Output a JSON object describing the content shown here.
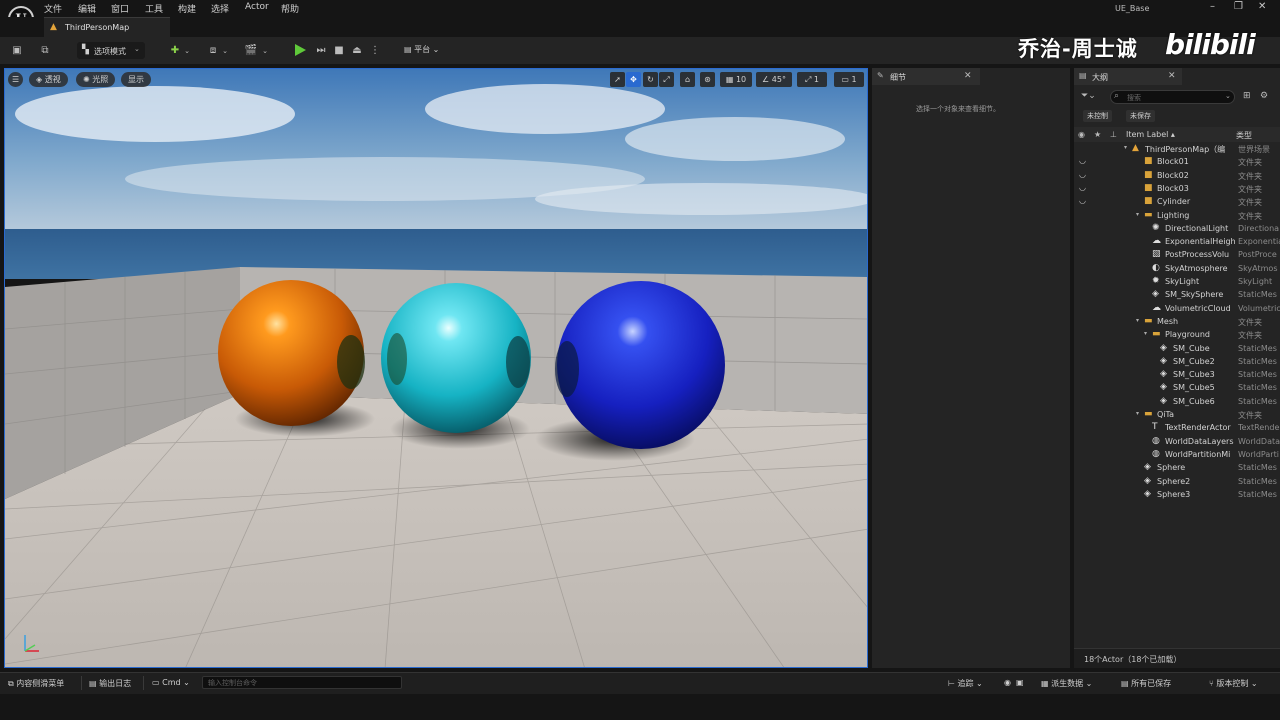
{
  "app": {
    "name": "UE_Base"
  },
  "menu": [
    "文件",
    "编辑",
    "窗口",
    "工具",
    "构建",
    "选择",
    "Actor",
    "帮助"
  ],
  "tab": {
    "map_name": "ThirdPersonMap"
  },
  "toolbar": {
    "select_mode": "选项模式",
    "platform": "平台"
  },
  "watermark": {
    "author": "乔治-周士诚",
    "site": "bilibili"
  },
  "viewport": {
    "perspective": "透视",
    "lit": "光照",
    "show": "显示",
    "grid_snap": "10",
    "angle_snap": "45°",
    "scale_snap": "1",
    "camera_speed": "1"
  },
  "details": {
    "title": "细节",
    "hint": "选择一个对象来查看细节。"
  },
  "outliner": {
    "title": "大纲",
    "search_placeholder": "搜索",
    "chip_uncontrolled": "未控制",
    "chip_unsaved": "未保存",
    "col_label": "Item Label ▴",
    "col_type": "类型",
    "rows": [
      {
        "name": "ThirdPersonMap（编",
        "type": "世界场景",
        "icon": "map-icon",
        "indent": 0,
        "arrow": "▾",
        "eye": false
      },
      {
        "name": "Block01",
        "type": "文件夹",
        "icon": "folder-icon",
        "indent": 1,
        "arrow": "",
        "eye": true
      },
      {
        "name": "Block02",
        "type": "文件夹",
        "icon": "folder-icon",
        "indent": 1,
        "arrow": "",
        "eye": true
      },
      {
        "name": "Block03",
        "type": "文件夹",
        "icon": "folder-icon",
        "indent": 1,
        "arrow": "",
        "eye": true
      },
      {
        "name": "Cylinder",
        "type": "文件夹",
        "icon": "folder-icon",
        "indent": 1,
        "arrow": "",
        "eye": true
      },
      {
        "name": "Lighting",
        "type": "文件夹",
        "icon": "folder-open-icon",
        "indent": 1,
        "arrow": "▾",
        "eye": false
      },
      {
        "name": "DirectionalLight",
        "type": "Directiona",
        "icon": "sun-icon",
        "indent": 2,
        "arrow": "",
        "eye": false
      },
      {
        "name": "ExponentialHeigh",
        "type": "Exponentia",
        "icon": "fog-icon",
        "indent": 2,
        "arrow": "",
        "eye": false
      },
      {
        "name": "PostProcessVolu",
        "type": "PostProce",
        "icon": "volume-icon",
        "indent": 2,
        "arrow": "",
        "eye": false
      },
      {
        "name": "SkyAtmosphere",
        "type": "SkyAtmos",
        "icon": "atmosphere-icon",
        "indent": 2,
        "arrow": "",
        "eye": false
      },
      {
        "name": "SkyLight",
        "type": "SkyLight",
        "icon": "skylight-icon",
        "indent": 2,
        "arrow": "",
        "eye": false
      },
      {
        "name": "SM_SkySphere",
        "type": "StaticMes",
        "icon": "mesh-icon",
        "indent": 2,
        "arrow": "",
        "eye": false
      },
      {
        "name": "VolumetricCloud",
        "type": "Volumetric",
        "icon": "cloud-icon",
        "indent": 2,
        "arrow": "",
        "eye": false
      },
      {
        "name": "Mesh",
        "type": "文件夹",
        "icon": "folder-open-icon",
        "indent": 1,
        "arrow": "▾",
        "eye": false
      },
      {
        "name": "Playground",
        "type": "文件夹",
        "icon": "folder-open-icon",
        "indent": 2,
        "arrow": "▾",
        "eye": false
      },
      {
        "name": "SM_Cube",
        "type": "StaticMes",
        "icon": "mesh-icon",
        "indent": 3,
        "arrow": "",
        "eye": false
      },
      {
        "name": "SM_Cube2",
        "type": "StaticMes",
        "icon": "mesh-icon",
        "indent": 3,
        "arrow": "",
        "eye": false
      },
      {
        "name": "SM_Cube3",
        "type": "StaticMes",
        "icon": "mesh-icon",
        "indent": 3,
        "arrow": "",
        "eye": false
      },
      {
        "name": "SM_Cube5",
        "type": "StaticMes",
        "icon": "mesh-icon",
        "indent": 3,
        "arrow": "",
        "eye": false
      },
      {
        "name": "SM_Cube6",
        "type": "StaticMes",
        "icon": "mesh-icon",
        "indent": 3,
        "arrow": "",
        "eye": false
      },
      {
        "name": "QiTa",
        "type": "文件夹",
        "icon": "folder-open-icon",
        "indent": 1,
        "arrow": "▾",
        "eye": false
      },
      {
        "name": "TextRenderActor",
        "type": "TextRende",
        "icon": "text-icon",
        "indent": 2,
        "arrow": "",
        "eye": false
      },
      {
        "name": "WorldDataLayers",
        "type": "WorldData",
        "icon": "globe-icon",
        "indent": 2,
        "arrow": "",
        "eye": false
      },
      {
        "name": "WorldPartitionMi",
        "type": "WorldParti",
        "icon": "globe-icon",
        "indent": 2,
        "arrow": "",
        "eye": false
      },
      {
        "name": "Sphere",
        "type": "StaticMes",
        "icon": "mesh-icon",
        "indent": 1,
        "arrow": "",
        "eye": false
      },
      {
        "name": "Sphere2",
        "type": "StaticMes",
        "icon": "mesh-icon",
        "indent": 1,
        "arrow": "",
        "eye": false
      },
      {
        "name": "Sphere3",
        "type": "StaticMes",
        "icon": "mesh-icon",
        "indent": 1,
        "arrow": "",
        "eye": false
      }
    ],
    "footer": "18个Actor（18个已加载）"
  },
  "statusbar": {
    "content_drawer": "内容侧滑菜单",
    "output_log": "输出日志",
    "cmd": "Cmd",
    "cmd_placeholder": "输入控制台命令",
    "trace": "追踪",
    "derived_data": "派生数据",
    "all_saved": "所有已保存",
    "source_control": "版本控制"
  },
  "colors": {
    "accent": "#2a6ad0",
    "sphere_orange": "#e0700c",
    "sphere_cyan": "#19c6d6",
    "sphere_blue": "#1a2ad8",
    "folder": "#d9a33a"
  }
}
